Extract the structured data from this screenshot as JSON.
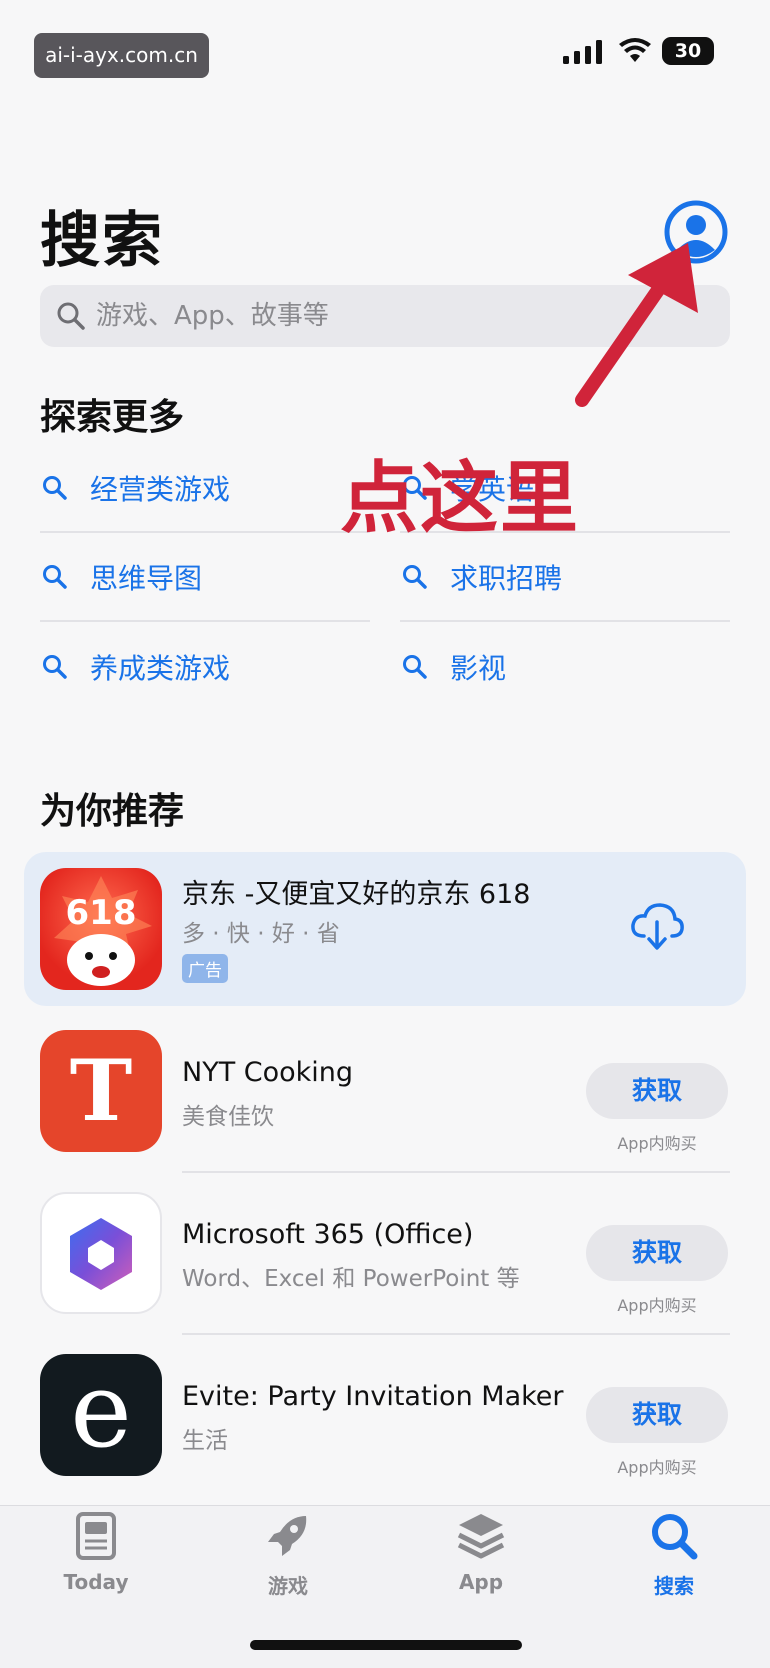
{
  "status_bar": {
    "watermark": "ai-i-ayx.com.cn",
    "battery": "30"
  },
  "header": {
    "title": "搜索",
    "search_placeholder": "游戏、App、故事等"
  },
  "annotation": {
    "text": "点这里",
    "color": "#d0243a"
  },
  "explore": {
    "title": "探索更多",
    "items": [
      {
        "label": "经营类游戏"
      },
      {
        "label": "学英语"
      },
      {
        "label": "思维导图"
      },
      {
        "label": "求职招聘"
      },
      {
        "label": "养成类游戏"
      },
      {
        "label": "影视"
      }
    ]
  },
  "recommend": {
    "title": "为你推荐",
    "apps": [
      {
        "name": "京东 -又便宜又好的京东 618",
        "subtitle": "多 · 快 · 好 · 省",
        "badge": "广告",
        "icon": "jd-icon",
        "icon_text": "618"
      },
      {
        "name": "NYT Cooking",
        "subtitle": "美食佳饮",
        "button": "获取",
        "iap": "App内购买",
        "icon": "nyt-icon",
        "icon_text": "T"
      },
      {
        "name": "Microsoft 365 (Office)",
        "subtitle": "Word、Excel 和 PowerPoint 等",
        "button": "获取",
        "iap": "App内购买",
        "icon": "microsoft-365-icon"
      },
      {
        "name": "Evite: Party Invitation Maker",
        "subtitle": "生活",
        "button": "获取",
        "iap": "App内购买",
        "icon": "evite-icon",
        "icon_text": "e"
      }
    ]
  },
  "tabbar": {
    "tabs": [
      {
        "label": "Today",
        "icon": "today-icon"
      },
      {
        "label": "游戏",
        "icon": "rocket-icon"
      },
      {
        "label": "App",
        "icon": "app-layers-icon"
      },
      {
        "label": "搜索",
        "icon": "search-icon",
        "active": true
      }
    ]
  },
  "colors": {
    "accent": "#1a73e8",
    "annotation_red": "#d0243a",
    "background": "#f7f7f8"
  }
}
